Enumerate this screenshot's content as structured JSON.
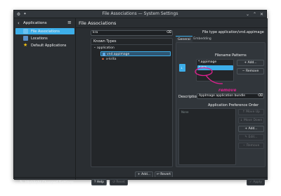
{
  "window": {
    "title": "File Associations — System Settings"
  },
  "sidebar": {
    "back_label": "Applications",
    "items": [
      {
        "label": "File Associations",
        "selected": true,
        "icon": "file-associations-icon"
      },
      {
        "label": "Locations",
        "selected": false,
        "icon": "locations-icon"
      },
      {
        "label": "Default Applications",
        "selected": false,
        "icon": "star-icon"
      }
    ],
    "footer_label": "Highlight Changed Settings"
  },
  "page": {
    "title": "File Associations"
  },
  "left_panel": {
    "search_value": "kra",
    "known_types_label": "Known Types",
    "tree": [
      {
        "label": "application",
        "level": 0,
        "expanded": true,
        "selected": false
      },
      {
        "label": "vnd.appimage",
        "level": 1,
        "selected": true
      },
      {
        "label": "x-krita",
        "level": 1,
        "selected": false
      }
    ],
    "add_label": "Add...",
    "revert_label": "Revert"
  },
  "right_panel": {
    "filetype_label": "File type application/vnd.appimage",
    "tabs": [
      {
        "label": "General",
        "active": true
      },
      {
        "label": "Embedding",
        "active": false
      }
    ],
    "patterns_title": "Filename Patterns",
    "patterns": [
      "*.appimage",
      "*.kra"
    ],
    "selected_pattern": 1,
    "annotation": "remove",
    "pattern_buttons": {
      "add": "Add...",
      "remove": "Remove"
    },
    "description_label": "Description:",
    "description_value": "AppImage application bundle",
    "pref_order_title": "Application Preference Order",
    "pref_list_placeholder": "None",
    "order_buttons": [
      {
        "label": "Move Up",
        "enabled": false
      },
      {
        "label": "Move Down",
        "enabled": false
      },
      {
        "label": "Add...",
        "enabled": true
      },
      {
        "label": "Edit...",
        "enabled": false
      },
      {
        "label": "Remove",
        "enabled": false
      }
    ]
  },
  "footer": {
    "help": "Help",
    "reset": "Reset",
    "apply": "Apply"
  },
  "colors": {
    "accent": "#3daee9",
    "annotation": "#e0208f"
  }
}
